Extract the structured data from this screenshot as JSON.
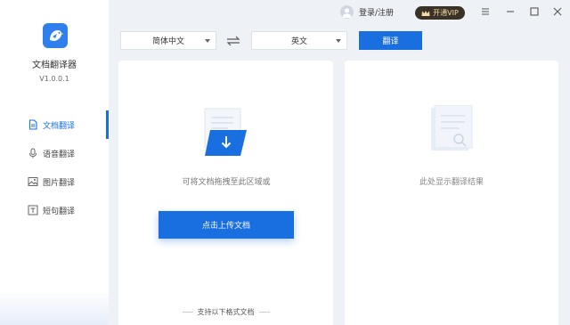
{
  "app": {
    "name": "文档翻译器",
    "version": "V1.0.0.1",
    "logo_icon": "bird-logo-icon",
    "accent": "#1a6fe0"
  },
  "titlebar": {
    "login_label": "登录/注册",
    "vip_label": "开通VIP",
    "menu_icon": "hamburger-menu-icon",
    "minimize_icon": "minimize-icon",
    "maximize_icon": "maximize-icon",
    "close_icon": "close-icon"
  },
  "sidebar": {
    "items": [
      {
        "label": "文档翻译",
        "icon": "document-icon",
        "active": true
      },
      {
        "label": "语音翻译",
        "icon": "microphone-icon",
        "active": false
      },
      {
        "label": "图片翻译",
        "icon": "image-icon",
        "active": false
      },
      {
        "label": "短句翻译",
        "icon": "text-icon",
        "active": false
      }
    ]
  },
  "lang_bar": {
    "source_lang": "简体中文",
    "target_lang": "英文",
    "swap_icon": "swap-arrows-icon",
    "translate_label": "翻译"
  },
  "upload_panel": {
    "hint": "可将文档拖拽至此区域或",
    "upload_label": "点击上传文档",
    "formats_label": "支持以下格式文档"
  },
  "result_panel": {
    "hint": "此处显示翻译结果"
  }
}
